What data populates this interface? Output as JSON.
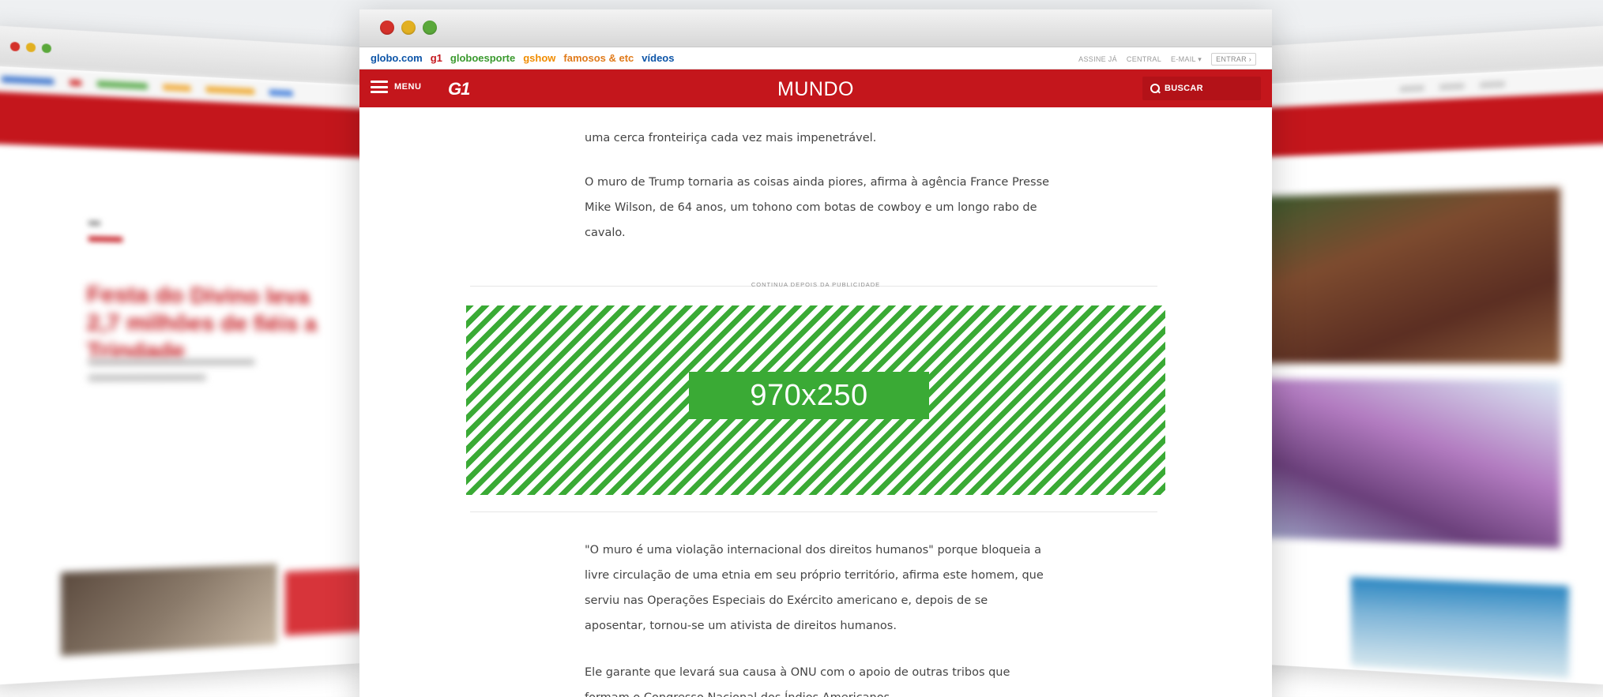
{
  "side_left": {
    "headline": "Festa do Divino leva 2,7 milhões de fiéis a Trindade"
  },
  "main": {
    "portal_links": [
      {
        "label": "globo.com",
        "color": "#0d55a8"
      },
      {
        "label": "g1",
        "color": "#c4161c"
      },
      {
        "label": "globoesporte",
        "color": "#3a9a2e"
      },
      {
        "label": "gshow",
        "color": "#f08c00"
      },
      {
        "label": "famosos & etc",
        "color": "#e07a1a"
      },
      {
        "label": "vídeos",
        "color": "#0d55a8"
      }
    ],
    "portal_right": {
      "assine": "ASSINE JÁ",
      "central": "CENTRAL",
      "email": "E-MAIL ▾",
      "entrar": "ENTRAR ›"
    },
    "nav": {
      "menu_label": "MENU",
      "logo": "G1",
      "section_title": "MUNDO",
      "search_label": "BUSCAR"
    },
    "paragraphs": [
      "uma cerca fronteiriça cada vez mais impenetrável.",
      "O muro de Trump tornaria as coisas ainda piores, afirma à agência France Presse Mike Wilson, de 64 anos, um tohono com botas de cowboy e um longo rabo de cavalo."
    ],
    "ad": {
      "label": "CONTINUA DEPOIS DA PUBLICIDADE",
      "size": "970x250"
    },
    "paragraphs_after": [
      "\"O muro é uma violação internacional dos direitos humanos\" porque bloqueia a livre circulação de uma etnia em seu próprio território, afirma este homem, que serviu nas Operações Especiais do Exército americano e, depois de se aposentar, tornou-se um ativista de direitos humanos.",
      "Ele garante que levará sua causa à ONU com o apoio de outras tribos que formam o Congresso Nacional dos Índios Americanos."
    ]
  },
  "colors": {
    "brand_red": "#c4161c",
    "ad_green": "#3aaa35",
    "dot_red": "#d4312a",
    "dot_yellow": "#e2b021",
    "dot_green": "#5aa83a"
  }
}
